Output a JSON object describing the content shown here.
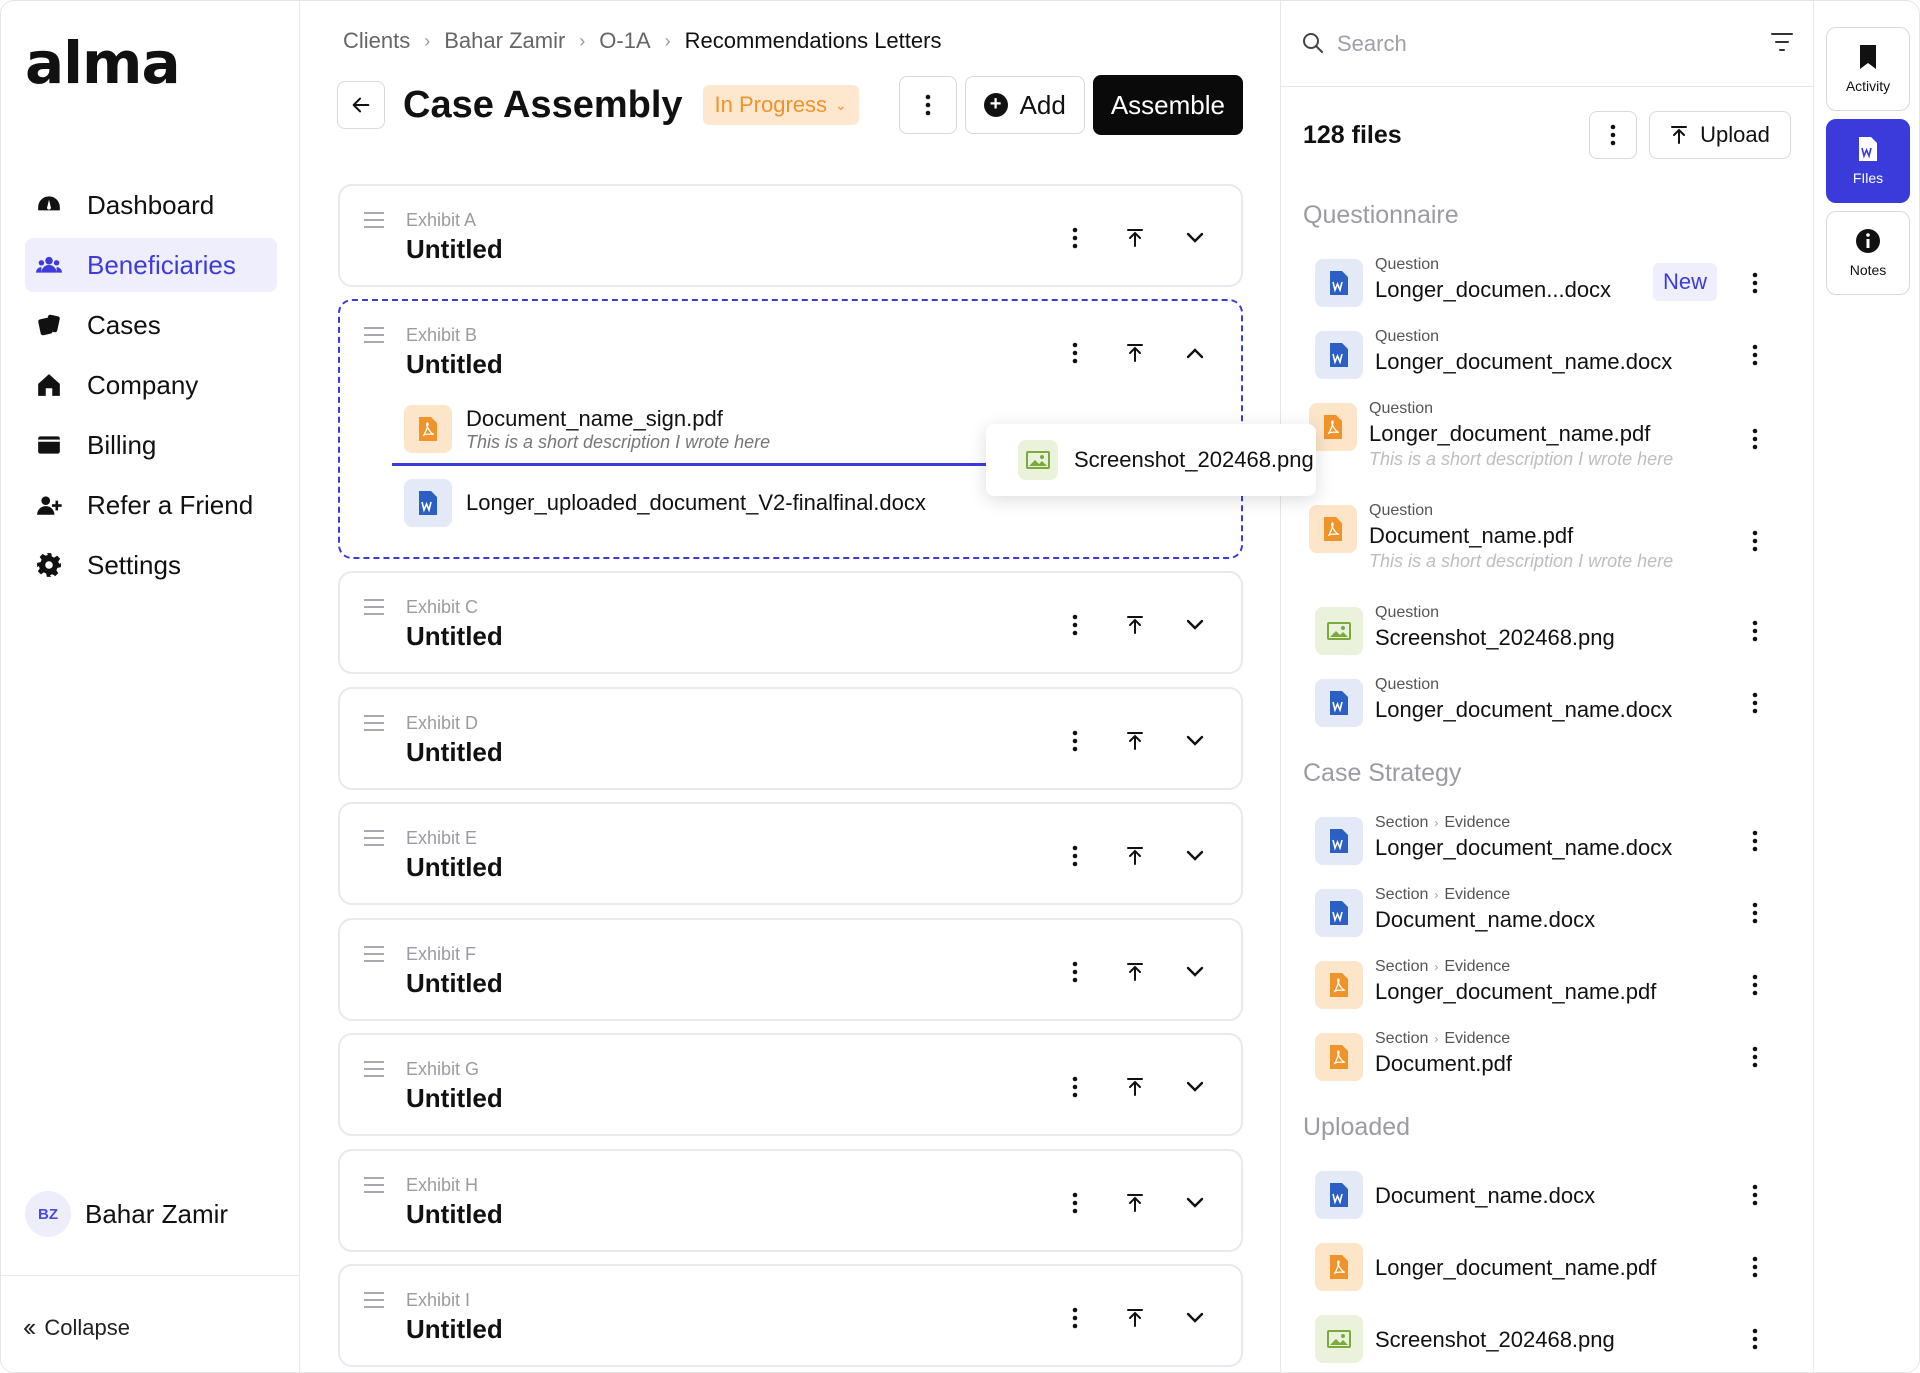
{
  "app": {
    "logo": "alma"
  },
  "sidebar": {
    "items": [
      {
        "label": "Dashboard",
        "icon": "dashboard-icon",
        "active": false
      },
      {
        "label": "Beneficiaries",
        "icon": "users-icon",
        "active": true
      },
      {
        "label": "Cases",
        "icon": "cards-icon",
        "active": false
      },
      {
        "label": "Company",
        "icon": "home-icon",
        "active": false
      },
      {
        "label": "Billing",
        "icon": "wallet-icon",
        "active": false
      },
      {
        "label": "Refer a Friend",
        "icon": "user-plus-icon",
        "active": false
      },
      {
        "label": "Settings",
        "icon": "gear-icon",
        "active": false
      }
    ],
    "user": {
      "initials": "BZ",
      "name": "Bahar Zamir"
    },
    "collapse_label": "Collapse"
  },
  "breadcrumb": [
    "Clients",
    "Bahar Zamir",
    "O-1A",
    "Recommendations Letters"
  ],
  "header": {
    "title": "Case Assembly",
    "status": "In Progress",
    "add_label": "Add",
    "assemble_label": "Assemble"
  },
  "exhibits": [
    {
      "label": "Exhibit A",
      "title": "Untitled"
    },
    {
      "label": "Exhibit B",
      "title": "Untitled",
      "documents": [
        {
          "name": "Document_name_sign.pdf",
          "description": "This is a short description I wrote here",
          "type": "pdf"
        },
        {
          "name": "Longer_uploaded_document_V2-finalfinal.docx",
          "type": "doc"
        }
      ]
    },
    {
      "label": "Exhibit C",
      "title": "Untitled"
    },
    {
      "label": "Exhibit D",
      "title": "Untitled"
    },
    {
      "label": "Exhibit E",
      "title": "Untitled"
    },
    {
      "label": "Exhibit F",
      "title": "Untitled"
    },
    {
      "label": "Exhibit G",
      "title": "Untitled"
    },
    {
      "label": "Exhibit H",
      "title": "Untitled"
    },
    {
      "label": "Exhibit I",
      "title": "Untitled"
    }
  ],
  "drag_ghost": {
    "name": "Screenshot_202468.png",
    "type": "img"
  },
  "files_panel": {
    "search_placeholder": "Search",
    "count_label": "128 files",
    "upload_label": "Upload",
    "groups": [
      {
        "title": "Questionnaire"
      },
      {
        "title": "Case Strategy"
      },
      {
        "title": "Uploaded"
      }
    ],
    "questionnaire": [
      {
        "meta": "Question",
        "name": "Longer_documen...docx",
        "type": "doc",
        "badge": "New"
      },
      {
        "meta": "Question",
        "name": "Longer_document_name.docx",
        "type": "doc"
      },
      {
        "meta": "Question",
        "name": "Longer_document_name.pdf",
        "type": "pdf",
        "description": "This is a short description I wrote here"
      },
      {
        "meta": "Question",
        "name": "Document_name.pdf",
        "type": "pdf",
        "description": "This is a short description I wrote here"
      },
      {
        "meta": "Question",
        "name": "Screenshot_202468.png",
        "type": "img"
      },
      {
        "meta": "Question",
        "name": "Longer_document_name.docx",
        "type": "doc"
      }
    ],
    "strategy": [
      {
        "meta1": "Section",
        "meta2": "Evidence",
        "name": "Longer_document_name.docx",
        "type": "doc"
      },
      {
        "meta1": "Section",
        "meta2": "Evidence",
        "name": "Document_name.docx",
        "type": "doc"
      },
      {
        "meta1": "Section",
        "meta2": "Evidence",
        "name": "Longer_document_name.pdf",
        "type": "pdf"
      },
      {
        "meta1": "Section",
        "meta2": "Evidence",
        "name": "Document.pdf",
        "type": "pdf"
      }
    ],
    "uploaded": [
      {
        "name": "Document_name.docx",
        "type": "doc"
      },
      {
        "name": "Longer_document_name.pdf",
        "type": "pdf"
      },
      {
        "name": "Screenshot_202468.png",
        "type": "img"
      }
    ]
  },
  "rail": [
    {
      "label": "Activity",
      "icon": "bookmark-icon",
      "active": false
    },
    {
      "label": "FIles",
      "icon": "word-file-icon",
      "active": true
    },
    {
      "label": "Notes",
      "icon": "info-icon",
      "active": false
    }
  ],
  "colors": {
    "accent": "#3b3bdc",
    "status_bg": "#fde8cf",
    "status_text": "#f0932b",
    "pdf": "#f0932b",
    "doc": "#2b5fc4",
    "img": "#7aab3a"
  }
}
